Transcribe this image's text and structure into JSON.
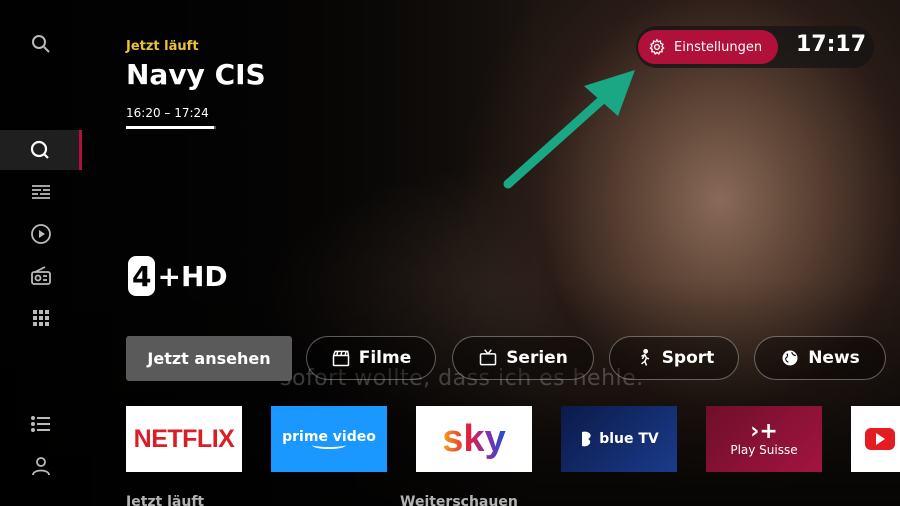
{
  "now_playing": {
    "label": "Jetzt läuft",
    "title": "Navy CIS",
    "time_range": "16:20 – 17:24",
    "progress": 0.98,
    "channel_logo": "4+HD"
  },
  "subtitle_text": "sofort wollte, dass ich es hehle.",
  "top_bar": {
    "settings_label": "Einstellungen",
    "clock": "17:17"
  },
  "sidebar": {
    "items": [
      {
        "icon": "search-icon"
      },
      {
        "icon": "home-icon",
        "active": true
      },
      {
        "icon": "tv-guide-icon"
      },
      {
        "icon": "play-circle-icon"
      },
      {
        "icon": "radio-icon"
      },
      {
        "icon": "apps-grid-icon"
      },
      {
        "icon": "list-icon"
      },
      {
        "icon": "profile-icon"
      }
    ]
  },
  "actions": {
    "watch_now": "Jetzt ansehen",
    "filters": [
      {
        "label": "Filme",
        "icon": "clapperboard-icon"
      },
      {
        "label": "Serien",
        "icon": "tv-icon"
      },
      {
        "label": "Sport",
        "icon": "runner-icon"
      },
      {
        "label": "News",
        "icon": "globe-icon"
      }
    ]
  },
  "apps": [
    {
      "name": "NETFLIX"
    },
    {
      "name": "prime video"
    },
    {
      "name": "sky"
    },
    {
      "name": "blue TV"
    },
    {
      "name": "Play Suisse"
    },
    {
      "name": "YouTube"
    }
  ],
  "sections": {
    "left": "Jetzt läuft",
    "right": "Weiterschauen"
  },
  "colors": {
    "accent": "#b0103a",
    "now_label": "#e7c23a",
    "arrow": "#1aa784"
  }
}
